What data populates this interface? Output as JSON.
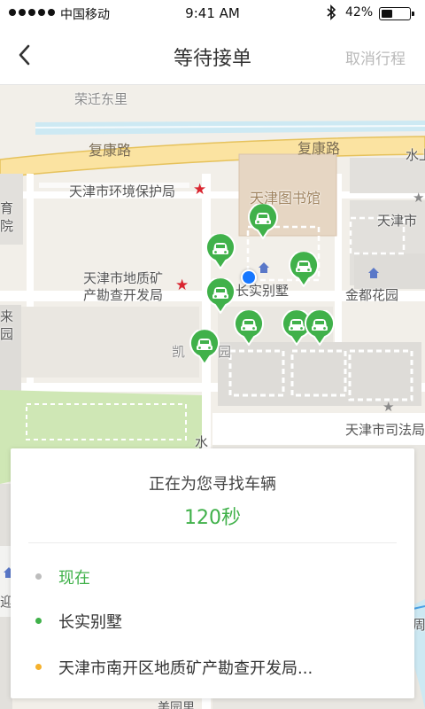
{
  "status_bar": {
    "carrier": "中国移动",
    "time": "9:41 AM",
    "battery_percent": "42%",
    "battery_level": 0.42
  },
  "nav": {
    "title": "等待接单",
    "cancel_label": "取消行程"
  },
  "map": {
    "labels": {
      "rongqian": "荣迁东里",
      "fukang_1": "复康路",
      "fukang_2": "复康路",
      "shui": "水上",
      "env_bureau": "天津市环境保护局",
      "library": "天津图书馆",
      "tianjin_city": "天津市",
      "geo_1": "天津市地质矿",
      "geo_2": "产勘查开发局",
      "changshi": "长实别墅",
      "jindu": "金都花园",
      "kaiyuan": "凯",
      "yuan": "园",
      "judicial": "天津市司法局",
      "shui_2": "水",
      "zhou": "周",
      "meiyuan": "美园里",
      "yu": "育",
      "yuan_left": "院",
      "lai": "来",
      "yuan_left2": "园",
      "ying": "迎"
    }
  },
  "card": {
    "title": "正在为您寻找车辆",
    "timer": "120秒",
    "rows": [
      {
        "text": "现在",
        "color": "#40b14a",
        "dot": "#bdbdbd"
      },
      {
        "text": "长实别墅",
        "color": "#333333",
        "dot": "#40b14a"
      },
      {
        "text": "天津市南开区地质矿产勘查开发局...",
        "color": "#333333",
        "dot": "#f5b12d"
      }
    ]
  },
  "colors": {
    "accent_green": "#40b14a",
    "user_blue": "#1677ff",
    "cancel_gray": "#b9b9b9"
  }
}
